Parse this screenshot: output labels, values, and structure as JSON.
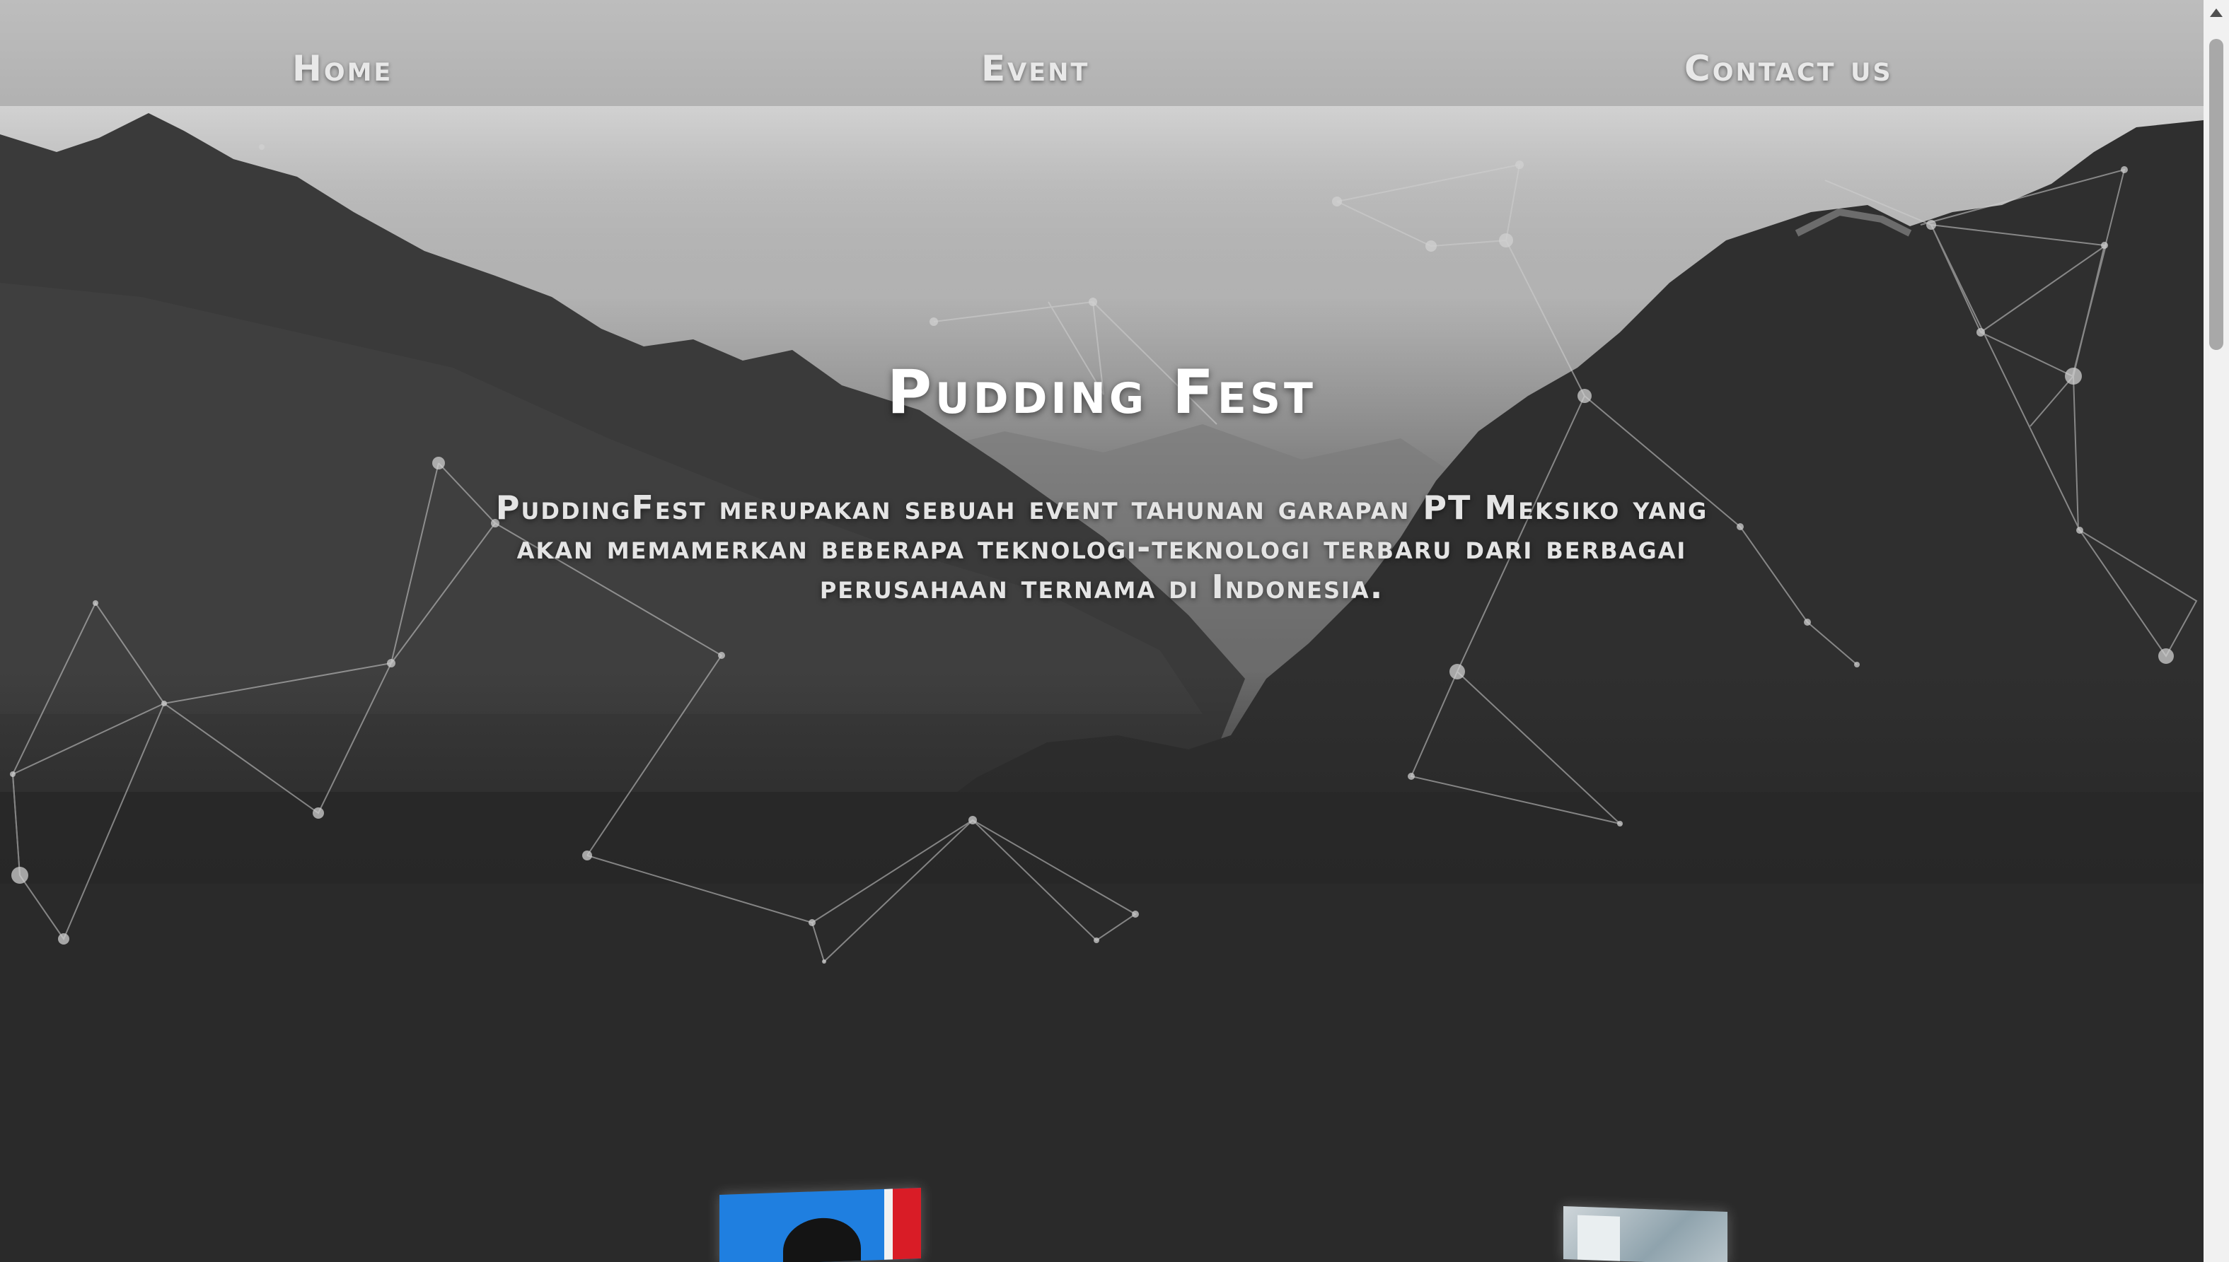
{
  "nav": {
    "home": "Home",
    "event": "Event",
    "contact": "Contact us"
  },
  "hero": {
    "title": "Pudding Fest",
    "description": "PuddingFest merupakan sebuah event tahunan garapan PT Meksiko yang akan memamerkan beberapa teknologi-teknologi terbaru dari berbagai perusahaan ternama di Indonesia."
  },
  "colors": {
    "background_dark": "#262626",
    "text": "#ffffff",
    "particle": "#c8c8c8"
  }
}
